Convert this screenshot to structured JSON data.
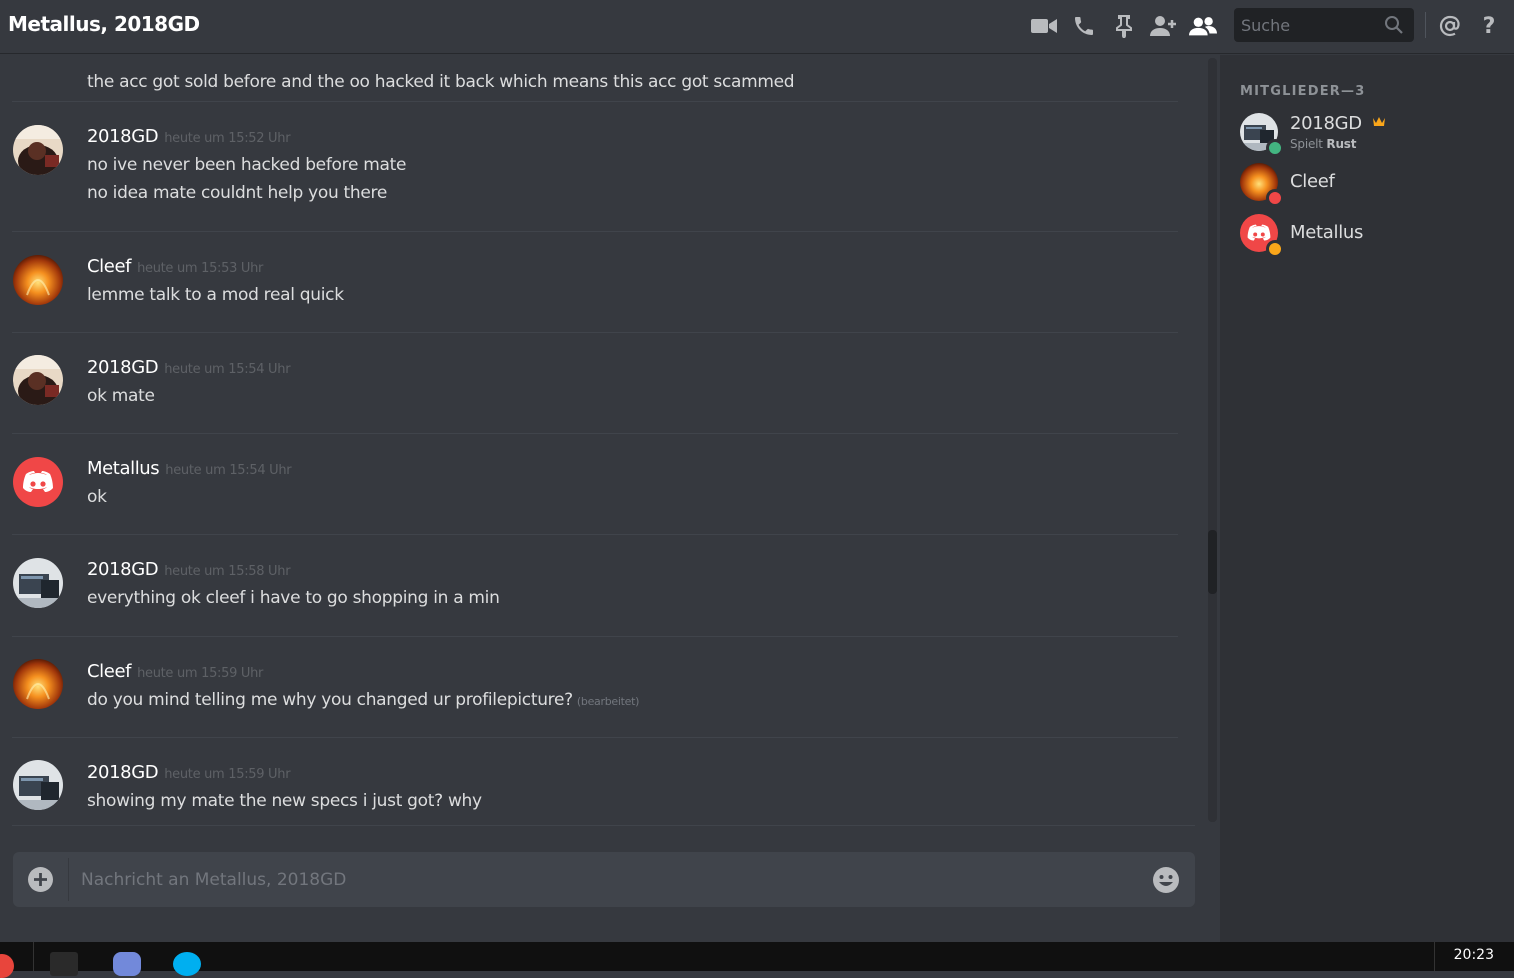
{
  "header": {
    "title": "Metallus, 2018GD",
    "icons": [
      "video-call-icon",
      "voice-call-icon",
      "pin-icon",
      "add-friend-icon",
      "members-icon",
      "search-icon",
      "mention-icon",
      "help-icon"
    ],
    "search_placeholder": "Suche"
  },
  "messages": [
    {
      "author": "",
      "time": "",
      "lines": [
        "the acc got sold before and the oo hacked it back which means this acc got scammed"
      ],
      "avatar": "fire"
    },
    {
      "author": "2018GD",
      "time": "heute um 15:52 Uhr",
      "lines": [
        "no ive never been hacked before mate",
        "no idea mate couldnt help you there"
      ],
      "avatar": "photo"
    },
    {
      "author": "Cleef",
      "time": "heute um 15:53 Uhr",
      "lines": [
        "lemme talk to a mod real quick"
      ],
      "avatar": "fire"
    },
    {
      "author": "2018GD",
      "time": "heute um 15:54 Uhr",
      "lines": [
        "ok mate"
      ],
      "avatar": "photo"
    },
    {
      "author": "Metallus",
      "time": "heute um 15:54 Uhr",
      "lines": [
        "ok"
      ],
      "avatar": "discord"
    },
    {
      "author": "2018GD",
      "time": "heute um 15:58 Uhr",
      "lines": [
        "everything ok cleef i have to go shopping in a min"
      ],
      "avatar": "desk"
    },
    {
      "author": "Cleef",
      "time": "heute um 15:59 Uhr",
      "lines": [
        "do you mind telling me why you changed ur profilepicture?"
      ],
      "edited": "(bearbeitet)",
      "avatar": "fire"
    },
    {
      "author": "2018GD",
      "time": "heute um 15:59 Uhr",
      "lines": [
        "showing my mate the  new specs i just got? why"
      ],
      "avatar": "desk"
    }
  ],
  "composer": {
    "placeholder": "Nachricht an Metallus, 2018GD"
  },
  "members": {
    "header": "MITGLIEDER—3",
    "list": [
      {
        "name": "2018GD",
        "activity_prefix": "Spielt",
        "activity_game": "Rust",
        "status": "online",
        "status_color": "#43b581",
        "owner": true,
        "avatar": "desk"
      },
      {
        "name": "Cleef",
        "status": "dnd",
        "status_color": "#f04747",
        "avatar": "fire"
      },
      {
        "name": "Metallus",
        "status": "idle",
        "status_color": "#faa61a",
        "avatar": "discord"
      }
    ]
  },
  "taskbar": {
    "clock": "20:23"
  },
  "colors": {
    "background": "#36393f",
    "sidebar": "#2f3136",
    "discord_red": "#f04747",
    "owner_crown": "#faa61a"
  }
}
